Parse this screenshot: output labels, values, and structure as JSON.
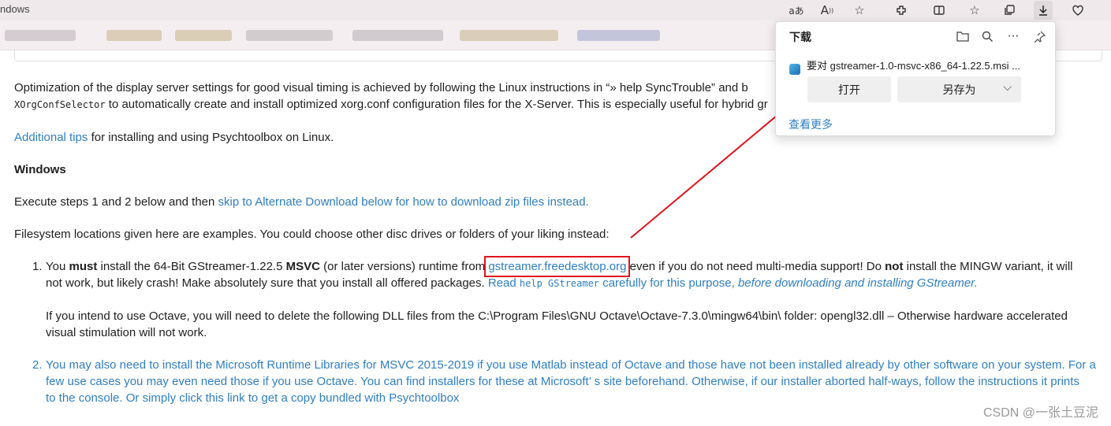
{
  "window": {
    "title": "ndows"
  },
  "toolbar": {
    "icons": [
      "text-size-icon",
      "read-aloud-icon",
      "favorite-star-icon",
      "extensions-icon",
      "split-screen-icon",
      "favorites-icon",
      "collections-icon",
      "downloads-icon",
      "copilot-icon"
    ],
    "read_aloud": "A",
    "text_size": "aあ"
  },
  "content": {
    "para1a": "Optimization of the display server settings for good visual timing is achieved by following the Linux instructions in  “» help SyncTrouble”  and b",
    "para1b_code": "XOrgConfSelector",
    "para1b_text": " to automatically create and install optimized xorg.conf configuration files for the X-Server. This is especially useful for hybrid gr",
    "tips_link": "Additional tips",
    "tips_text": " for installing and using Psychtoolbox on Linux.",
    "heading": "Windows",
    "exec_text": "Execute steps 1 and 2 below and then ",
    "exec_link": "skip to Alternate Download below for how to download zip files instead.",
    "fs_text": "Filesystem locations given here are examples. You could choose other disc drives or folders of your liking instead:",
    "item1_num": "1.",
    "item1_a": "You ",
    "item1_must": "must",
    "item1_b": " install the 64-Bit GStreamer-1.22.5 ",
    "item1_msvc": "MSVC",
    "item1_c": " (or later versions) runtime from ",
    "item1_link": "gstreamer.freedesktop.org",
    "item1_d": " even if you do not need multi-media support! Do ",
    "item1_not": "not",
    "item1_e": " install the MINGW variant, it will",
    "item1_line2": "not work, but likely crash! Make absolutely sure that you install all offered packages. ",
    "item1_read": "Read ",
    "item1_help_code": "help GStreamer",
    "item1_careful": " carefully for this purpose, ",
    "item1_italic": "before downloading and installing GStreamer.",
    "octave_line1": "If you intend to use Octave, you will need to delete the following DLL files from the C:\\Program Files\\GNU Octave\\Octave-7.3.0\\mingw64\\bin\\ folder: opengl32.dll – Otherwise hardware accelerated",
    "octave_line2": "visual stimulation will not work.",
    "item2_num": "2.",
    "item2_line1": "You may also need to install the Microsoft Runtime Libraries for MSVC 2015-2019 if you use Matlab instead of Octave and those have not been installed already by other software on your system. For a",
    "item2_line2": "few use cases you may even need those if you use Octave. You can find installers for these at Microsoft’ s site beforehand. Otherwise, if our installer aborted half-ways, follow the instructions it prints",
    "item2_line3": "to the console. Or simply click this link to get a copy bundled with Psychtoolbox"
  },
  "downloads": {
    "title": "下载",
    "file": "要对 gstreamer-1.0-msvc-x86_64-1.22.5.msi ...",
    "open_btn": "打开",
    "saveas_btn": "另存为",
    "more_link": "查看更多",
    "icons": [
      "folder-icon",
      "search-icon",
      "more-icon",
      "pin-icon"
    ]
  },
  "watermark": "CSDN @一张土豆泥",
  "colors": {
    "link": "#2f7fc1",
    "highlight": "#e0141c",
    "titlebar": "#f0e9ec"
  }
}
